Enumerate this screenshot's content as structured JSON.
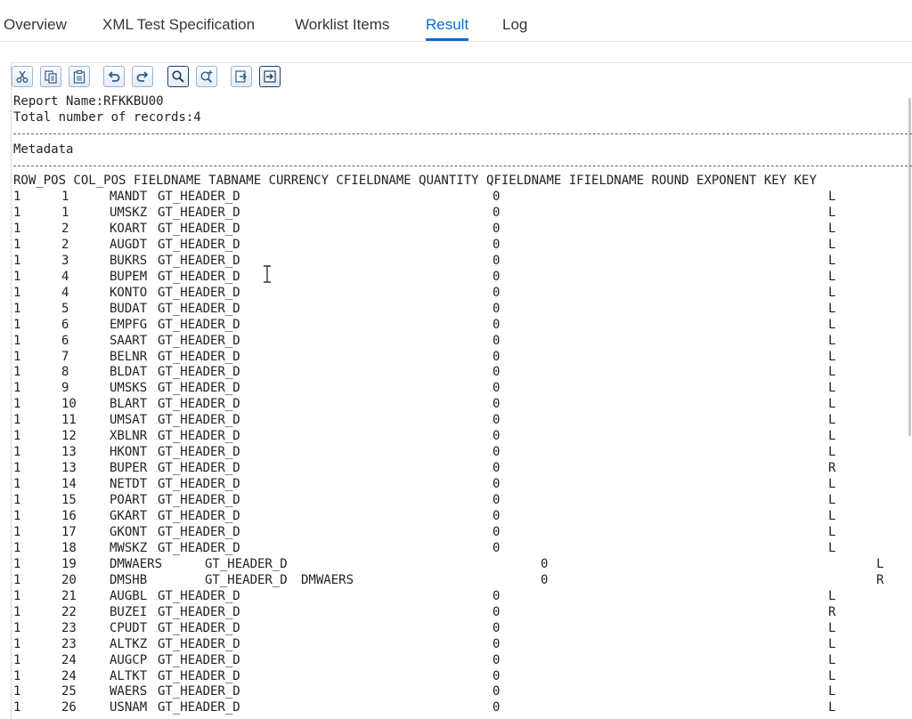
{
  "tabs": [
    {
      "label": "Overview",
      "active": false
    },
    {
      "label": "XML Test Specification",
      "active": false
    },
    {
      "label": "Worklist Items",
      "active": false
    },
    {
      "label": "Result",
      "active": true
    },
    {
      "label": "Log",
      "active": false
    }
  ],
  "toolbar": {
    "icons": [
      "cut-icon",
      "copy-icon",
      "paste-icon",
      "undo-icon",
      "redo-icon",
      "find-icon",
      "find-next-icon",
      "save-local-icon",
      "load-local-icon"
    ]
  },
  "report": {
    "name_line": "Report Name:RFKKBU00",
    "total_line": "Total number of records:4",
    "section_title": "Metadata",
    "header_line": "ROW_POS COL_POS FIELDNAME TABNAME CURRENCY CFIELDNAME QUANTITY QFIELDNAME IFIELDNAME ROUND EXPONENT KEY KEY",
    "rows": [
      {
        "row": "1",
        "col": "1",
        "field": "MANDT",
        "tab": "GT_HEADER_D",
        "cfield": "",
        "zero": "0",
        "align": "L",
        "wide": false
      },
      {
        "row": "1",
        "col": "1",
        "field": "UMSKZ",
        "tab": "GT_HEADER_D",
        "cfield": "",
        "zero": "0",
        "align": "L",
        "wide": false
      },
      {
        "row": "1",
        "col": "2",
        "field": "KOART",
        "tab": "GT_HEADER_D",
        "cfield": "",
        "zero": "0",
        "align": "L",
        "wide": false
      },
      {
        "row": "1",
        "col": "2",
        "field": "AUGDT",
        "tab": "GT_HEADER_D",
        "cfield": "",
        "zero": "0",
        "align": "L",
        "wide": false
      },
      {
        "row": "1",
        "col": "3",
        "field": "BUKRS",
        "tab": "GT_HEADER_D",
        "cfield": "",
        "zero": "0",
        "align": "L",
        "wide": false
      },
      {
        "row": "1",
        "col": "4",
        "field": "BUPEM",
        "tab": "GT_HEADER_D",
        "cfield": "",
        "zero": "0",
        "align": "L",
        "wide": false
      },
      {
        "row": "1",
        "col": "4",
        "field": "KONTO",
        "tab": "GT_HEADER_D",
        "cfield": "",
        "zero": "0",
        "align": "L",
        "wide": false
      },
      {
        "row": "1",
        "col": "5",
        "field": "BUDAT",
        "tab": "GT_HEADER_D",
        "cfield": "",
        "zero": "0",
        "align": "L",
        "wide": false
      },
      {
        "row": "1",
        "col": "6",
        "field": "EMPFG",
        "tab": "GT_HEADER_D",
        "cfield": "",
        "zero": "0",
        "align": "L",
        "wide": false
      },
      {
        "row": "1",
        "col": "6",
        "field": "SAART",
        "tab": "GT_HEADER_D",
        "cfield": "",
        "zero": "0",
        "align": "L",
        "wide": false
      },
      {
        "row": "1",
        "col": "7",
        "field": "BELNR",
        "tab": "GT_HEADER_D",
        "cfield": "",
        "zero": "0",
        "align": "L",
        "wide": false
      },
      {
        "row": "1",
        "col": "8",
        "field": "BLDAT",
        "tab": "GT_HEADER_D",
        "cfield": "",
        "zero": "0",
        "align": "L",
        "wide": false
      },
      {
        "row": "1",
        "col": "9",
        "field": "UMSKS",
        "tab": "GT_HEADER_D",
        "cfield": "",
        "zero": "0",
        "align": "L",
        "wide": false
      },
      {
        "row": "1",
        "col": "10",
        "field": "BLART",
        "tab": "GT_HEADER_D",
        "cfield": "",
        "zero": "0",
        "align": "L",
        "wide": false
      },
      {
        "row": "1",
        "col": "11",
        "field": "UMSAT",
        "tab": "GT_HEADER_D",
        "cfield": "",
        "zero": "0",
        "align": "L",
        "wide": false
      },
      {
        "row": "1",
        "col": "12",
        "field": "XBLNR",
        "tab": "GT_HEADER_D",
        "cfield": "",
        "zero": "0",
        "align": "L",
        "wide": false
      },
      {
        "row": "1",
        "col": "13",
        "field": "HKONT",
        "tab": "GT_HEADER_D",
        "cfield": "",
        "zero": "0",
        "align": "L",
        "wide": false
      },
      {
        "row": "1",
        "col": "13",
        "field": "BUPER",
        "tab": "GT_HEADER_D",
        "cfield": "",
        "zero": "0",
        "align": "R",
        "wide": false
      },
      {
        "row": "1",
        "col": "14",
        "field": "NETDT",
        "tab": "GT_HEADER_D",
        "cfield": "",
        "zero": "0",
        "align": "L",
        "wide": false
      },
      {
        "row": "1",
        "col": "15",
        "field": "POART",
        "tab": "GT_HEADER_D",
        "cfield": "",
        "zero": "0",
        "align": "L",
        "wide": false
      },
      {
        "row": "1",
        "col": "16",
        "field": "GKART",
        "tab": "GT_HEADER_D",
        "cfield": "",
        "zero": "0",
        "align": "L",
        "wide": false
      },
      {
        "row": "1",
        "col": "17",
        "field": "GKONT",
        "tab": "GT_HEADER_D",
        "cfield": "",
        "zero": "0",
        "align": "L",
        "wide": false
      },
      {
        "row": "1",
        "col": "18",
        "field": "MWSKZ",
        "tab": "GT_HEADER_D",
        "cfield": "",
        "zero": "0",
        "align": "L",
        "wide": false
      },
      {
        "row": "1",
        "col": "19",
        "field": "DMWAERS",
        "tab": "GT_HEADER_D",
        "cfield": "",
        "zero": "0",
        "align": "L",
        "wide": true
      },
      {
        "row": "1",
        "col": "20",
        "field": "DMSHB",
        "tab": "GT_HEADER_D",
        "cfield": "DMWAERS",
        "zero": "0",
        "align": "R",
        "wide": true
      },
      {
        "row": "1",
        "col": "21",
        "field": "AUGBL",
        "tab": "GT_HEADER_D",
        "cfield": "",
        "zero": "0",
        "align": "L",
        "wide": false
      },
      {
        "row": "1",
        "col": "22",
        "field": "BUZEI",
        "tab": "GT_HEADER_D",
        "cfield": "",
        "zero": "0",
        "align": "R",
        "wide": false
      },
      {
        "row": "1",
        "col": "23",
        "field": "CPUDT",
        "tab": "GT_HEADER_D",
        "cfield": "",
        "zero": "0",
        "align": "L",
        "wide": false
      },
      {
        "row": "1",
        "col": "23",
        "field": "ALTKZ",
        "tab": "GT_HEADER_D",
        "cfield": "",
        "zero": "0",
        "align": "L",
        "wide": false
      },
      {
        "row": "1",
        "col": "24",
        "field": "AUGCP",
        "tab": "GT_HEADER_D",
        "cfield": "",
        "zero": "0",
        "align": "L",
        "wide": false
      },
      {
        "row": "1",
        "col": "24",
        "field": "ALTKT",
        "tab": "GT_HEADER_D",
        "cfield": "",
        "zero": "0",
        "align": "L",
        "wide": false
      },
      {
        "row": "1",
        "col": "25",
        "field": "WAERS",
        "tab": "GT_HEADER_D",
        "cfield": "",
        "zero": "0",
        "align": "L",
        "wide": false
      },
      {
        "row": "1",
        "col": "26",
        "field": "USNAM",
        "tab": "GT_HEADER_D",
        "cfield": "",
        "zero": "0",
        "align": "L",
        "wide": false
      }
    ]
  },
  "colors": {
    "accent": "#0a6ed1",
    "text": "#222222"
  }
}
